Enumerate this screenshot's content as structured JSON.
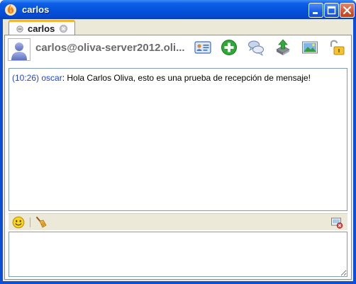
{
  "window": {
    "title": "carlos",
    "icons": {
      "app": "spark-flame-icon",
      "minimize": "minimize-icon",
      "maximize": "maximize-icon",
      "close": "close-icon"
    }
  },
  "tabs": [
    {
      "label": "carlos",
      "status_icon": "presence-icon",
      "close_icon": "tab-close-icon"
    }
  ],
  "contact": {
    "display": "carlos@oliva-server2012.oli...",
    "avatar_icon": "user-avatar-icon"
  },
  "toolbar": {
    "icons": [
      "contact-card-icon",
      "add-contact-icon",
      "chat-history-icon",
      "send-file-icon",
      "send-image-icon",
      "unlock-icon"
    ]
  },
  "transcript": {
    "messages": [
      {
        "time": "(10:26)",
        "sender": "oscar",
        "separator": ": ",
        "text": "Hola Carlos Oliva, esto es una prueba de recepción de mensaje!"
      }
    ]
  },
  "input_toolbar": {
    "icons": [
      "emoticon-icon",
      "clear-broom-icon",
      "screenshot-icon"
    ]
  },
  "compose": {
    "value": ""
  },
  "colors": {
    "titlebar": "#0653dd",
    "client_bg": "#ece9d8",
    "message_meta": "#2244cc",
    "tab_accent": "#f6b42b"
  }
}
